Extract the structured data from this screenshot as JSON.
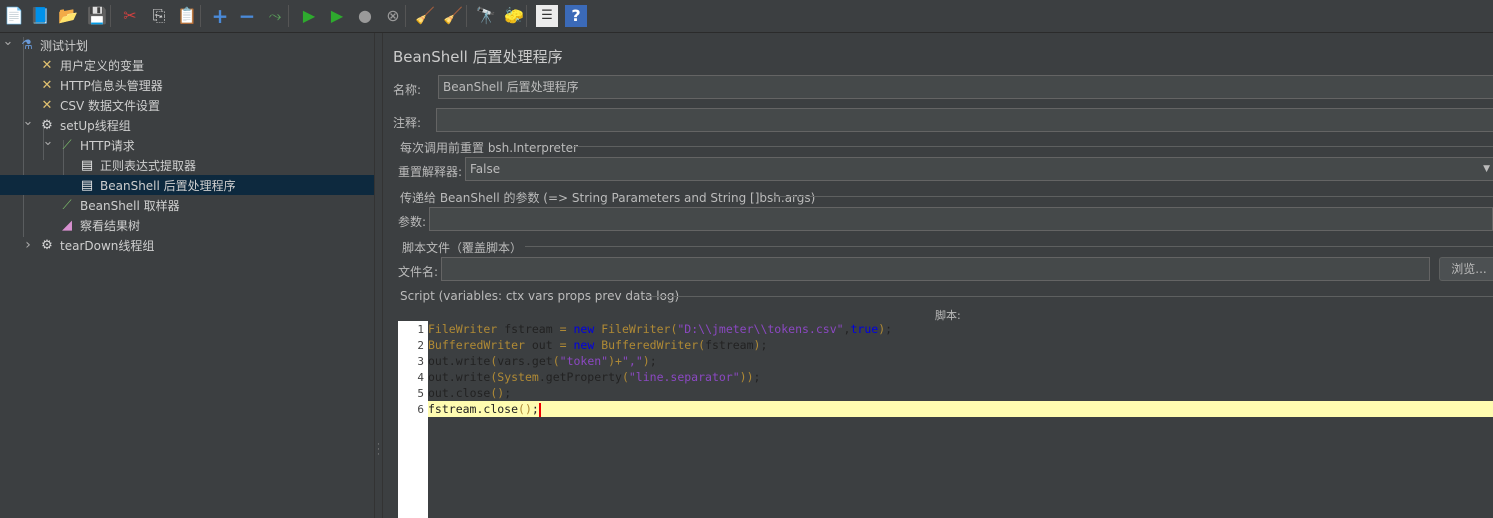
{
  "toolbar": {
    "buttons": [
      {
        "name": "new-icon",
        "glyph": "📄"
      },
      {
        "name": "templates-icon",
        "glyph": "📘"
      },
      {
        "name": "open-icon",
        "glyph": "📂"
      },
      {
        "name": "save-icon",
        "glyph": "💾"
      },
      {
        "name": "cut-icon",
        "glyph": "✂"
      },
      {
        "name": "copy-icon",
        "glyph": "⎘"
      },
      {
        "name": "paste-icon",
        "glyph": "📋"
      },
      {
        "name": "expand-icon",
        "glyph": "+"
      },
      {
        "name": "collapse-icon",
        "glyph": "−"
      },
      {
        "name": "toggle-icon",
        "glyph": "⤳"
      },
      {
        "name": "start-icon",
        "glyph": "▶"
      },
      {
        "name": "start-no-pause-icon",
        "glyph": "▶"
      },
      {
        "name": "stop-icon",
        "glyph": "●"
      },
      {
        "name": "shutdown-icon",
        "glyph": "⊗"
      },
      {
        "name": "clear-icon",
        "glyph": "🧹"
      },
      {
        "name": "clear-all-icon",
        "glyph": "🧹"
      },
      {
        "name": "search-icon",
        "glyph": "🔭"
      },
      {
        "name": "reset-search-icon",
        "glyph": "🧽"
      },
      {
        "name": "function-helper-icon",
        "glyph": "☰"
      },
      {
        "name": "help-icon",
        "glyph": "?"
      }
    ]
  },
  "tree": {
    "items": [
      {
        "label": "测试计划",
        "icon": "flask-icon",
        "glyph": "⚗",
        "expanded": true
      },
      {
        "label": "用户定义的变量",
        "icon": "wrench-icon",
        "glyph": "✕"
      },
      {
        "label": "HTTP信息头管理器",
        "icon": "wrench-icon",
        "glyph": "✕"
      },
      {
        "label": "CSV 数据文件设置",
        "icon": "wrench-icon",
        "glyph": "✕"
      },
      {
        "label": "setUp线程组",
        "icon": "gear-icon",
        "glyph": "⚙",
        "expanded": true
      },
      {
        "label": "HTTP请求",
        "icon": "pipette-icon",
        "glyph": "⟋",
        "expanded": true
      },
      {
        "label": "正则表达式提取器",
        "icon": "script-doc-icon",
        "glyph": "▤"
      },
      {
        "label": "BeanShell 后置处理程序",
        "icon": "script-doc-icon",
        "glyph": "▤",
        "selected": true
      },
      {
        "label": "BeanShell 取样器",
        "icon": "pipette-icon",
        "glyph": "⟋"
      },
      {
        "label": "察看结果树",
        "icon": "chart-icon",
        "glyph": "◢"
      },
      {
        "label": "tearDown线程组",
        "icon": "gear-icon",
        "glyph": "⚙",
        "expanded": false
      }
    ]
  },
  "panel": {
    "title": "BeanShell 后置处理程序",
    "name_label": "名称:",
    "name_value": "BeanShell 后置处理程序",
    "comment_label": "注释:",
    "comment_value": "",
    "reset_section": "每次调用前重置 bsh.Interpreter",
    "reset_label": "重置解释器:",
    "reset_value": "False",
    "params_section": "传递给 BeanShell 的参数 (=> String Parameters and String []bsh.args)",
    "params_label": "参数:",
    "params_value": "",
    "file_section": "脚本文件（覆盖脚本）",
    "file_label": "文件名:",
    "file_value": "",
    "browse_label": "浏览...",
    "script_section": "Script (variables: ctx vars props prev data log)",
    "script_label": "脚本:"
  },
  "script": {
    "lines": [
      "FileWriter fstream = new FileWriter(\"D:\\\\jmeter\\\\tokens.csv\",true);",
      "BufferedWriter out = new BufferedWriter(fstream);",
      "out.write(vars.get(\"token\")+\",\");",
      "out.write(System.getProperty(\"line.separator\"));",
      "out.close();",
      "fstream.close();"
    ],
    "current_line": 6
  },
  "colors": {
    "keyword": "#0000e0",
    "type": "#b08a35",
    "string": "#8b48c2",
    "plain": "#222222",
    "selection": "#0d293e"
  }
}
